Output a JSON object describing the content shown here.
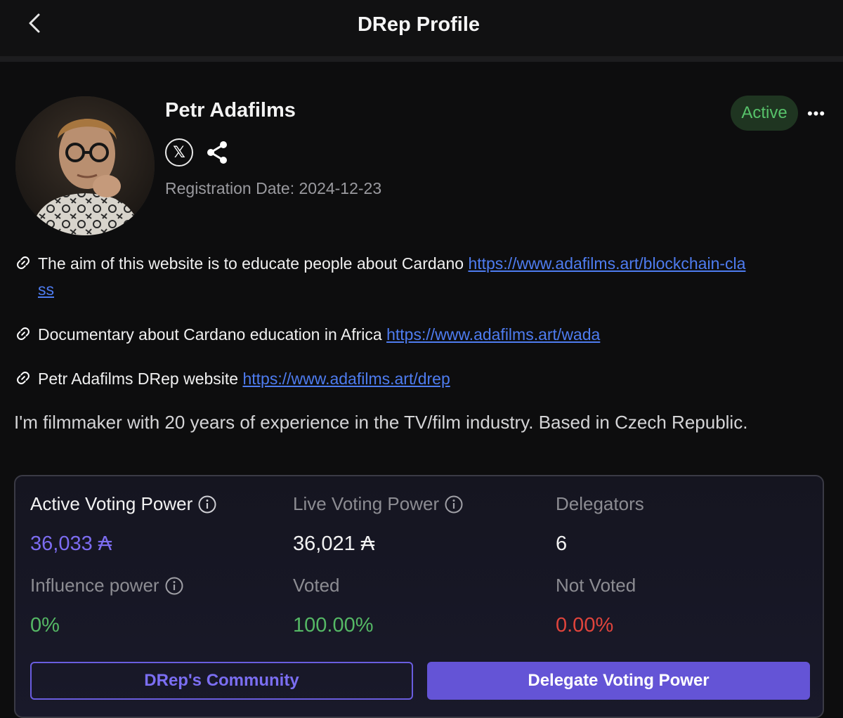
{
  "header": {
    "title": "DRep Profile"
  },
  "profile": {
    "name": "Petr Adafilms",
    "registration_date": "Registration Date: 2024-12-23",
    "status": "Active",
    "x_icon_glyph": "𝕏",
    "more_glyph": "•••"
  },
  "links": [
    {
      "text": "The aim of this website is to educate people about Cardano",
      "url_part1": "https://www.adafilms.art/blockchain-cla",
      "url_part2": "ss"
    },
    {
      "text": "Documentary about Cardano education in Africa",
      "url": "https://www.adafilms.art/wada"
    },
    {
      "text": "Petr Adafilms DRep website",
      "url": "https://www.adafilms.art/drep"
    }
  ],
  "bio": "I'm filmmaker with 20 years of experience in the TV/film industry. Based in Czech Republic.",
  "stats": {
    "active_voting_power_label": "Active Voting Power",
    "active_voting_power_value": "36,033 ₳",
    "live_voting_power_label": "Live Voting Power",
    "live_voting_power_value": "36,021 ₳",
    "delegators_label": "Delegators",
    "delegators_value": "6",
    "influence_power_label": "Influence power",
    "influence_power_value": "0%",
    "voted_label": "Voted",
    "voted_value": "100.00%",
    "not_voted_label": "Not Voted",
    "not_voted_value": "0.00%"
  },
  "actions": {
    "community_label": "DRep's Community",
    "delegate_label": "Delegate Voting Power"
  },
  "colors": {
    "accent_purple": "#6454d6",
    "active_green": "#57c26a",
    "link_blue": "#4e7cf0",
    "red": "#e0443c"
  },
  "icons": [
    "back-arrow-icon",
    "x-twitter-icon",
    "share-icon",
    "more-icon",
    "link-icon",
    "info-icon"
  ]
}
